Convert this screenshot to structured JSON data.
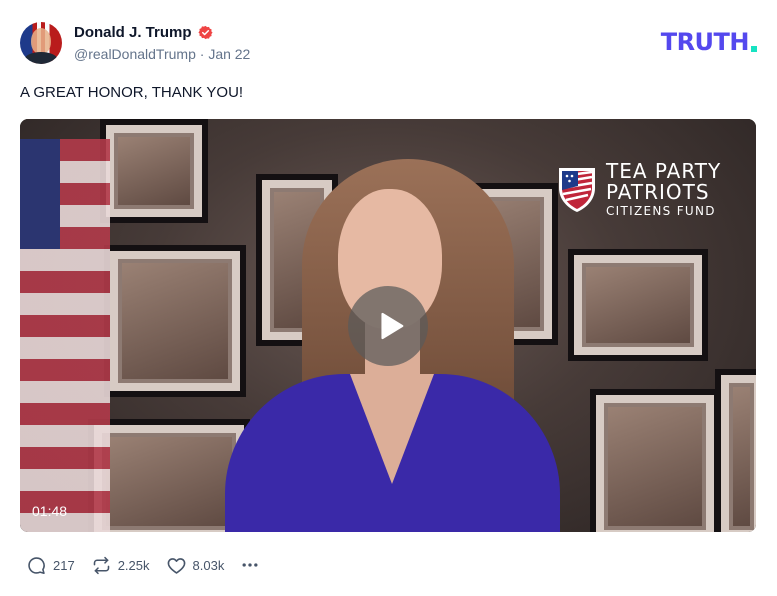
{
  "author": {
    "display_name": "Donald J. Trump",
    "handle": "@realDonaldTrump",
    "separator": "·",
    "date": "Jan 22",
    "verified": true
  },
  "brand": {
    "logo_text": "TRUTH",
    "logo_color": "#5448ee",
    "dot_color": "#17e3c2"
  },
  "post": {
    "text": "A GREAT HONOR, THANK YOU!"
  },
  "video": {
    "duration": "01:48",
    "overlay_logo": {
      "line1": "TEA PARTY",
      "line2": "PATRIOTS",
      "line3": "CITIZENS FUND"
    },
    "play_icon": "play-icon"
  },
  "actions": {
    "replies": "217",
    "retruths": "2.25k",
    "likes": "8.03k",
    "more_icon": "ellipsis-icon"
  },
  "colors": {
    "verified": "#ef4444",
    "text_secondary": "#64748b"
  }
}
